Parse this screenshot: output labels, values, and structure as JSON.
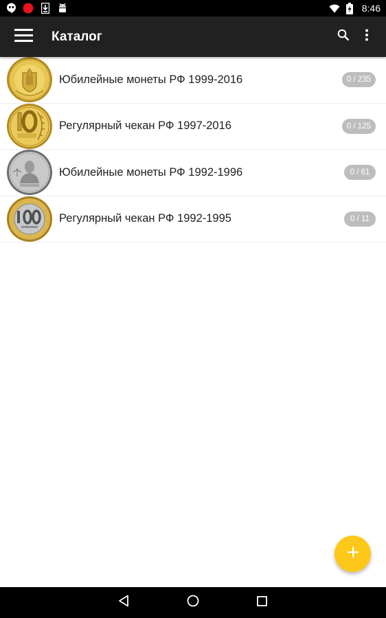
{
  "status_bar": {
    "time": "8:46",
    "left_icons": [
      "hangouts-icon",
      "record-icon",
      "download-icon",
      "android-icon"
    ],
    "right_icons": [
      "wifi-icon",
      "battery-charging-icon"
    ]
  },
  "app_bar": {
    "title": "Каталог",
    "menu_icon": "hamburger-icon",
    "actions": [
      "search-icon",
      "more-vert-icon"
    ],
    "background": "#212121"
  },
  "catalog": {
    "items": [
      {
        "label": "Юбилейные монеты РФ 1999-2016",
        "count": "0 / 235",
        "coin_icon": "gold-commemorative-coin"
      },
      {
        "label": "Регулярный чекан РФ 1997-2016",
        "count": "0 / 125",
        "coin_icon": "gold-10-ruble-coin"
      },
      {
        "label": "Юбилейные монеты РФ 1992-1996",
        "count": "0 / 61",
        "coin_icon": "silver-portrait-coin"
      },
      {
        "label": "Регулярный чекан РФ 1992-1995",
        "count": "0 / 11",
        "coin_icon": "bimetal-100-ruble-coin"
      }
    ]
  },
  "fab": {
    "icon": "plus-icon",
    "color": "#fdc81a"
  },
  "nav_bar": {
    "buttons": [
      "back-icon",
      "home-icon",
      "recents-icon"
    ]
  }
}
